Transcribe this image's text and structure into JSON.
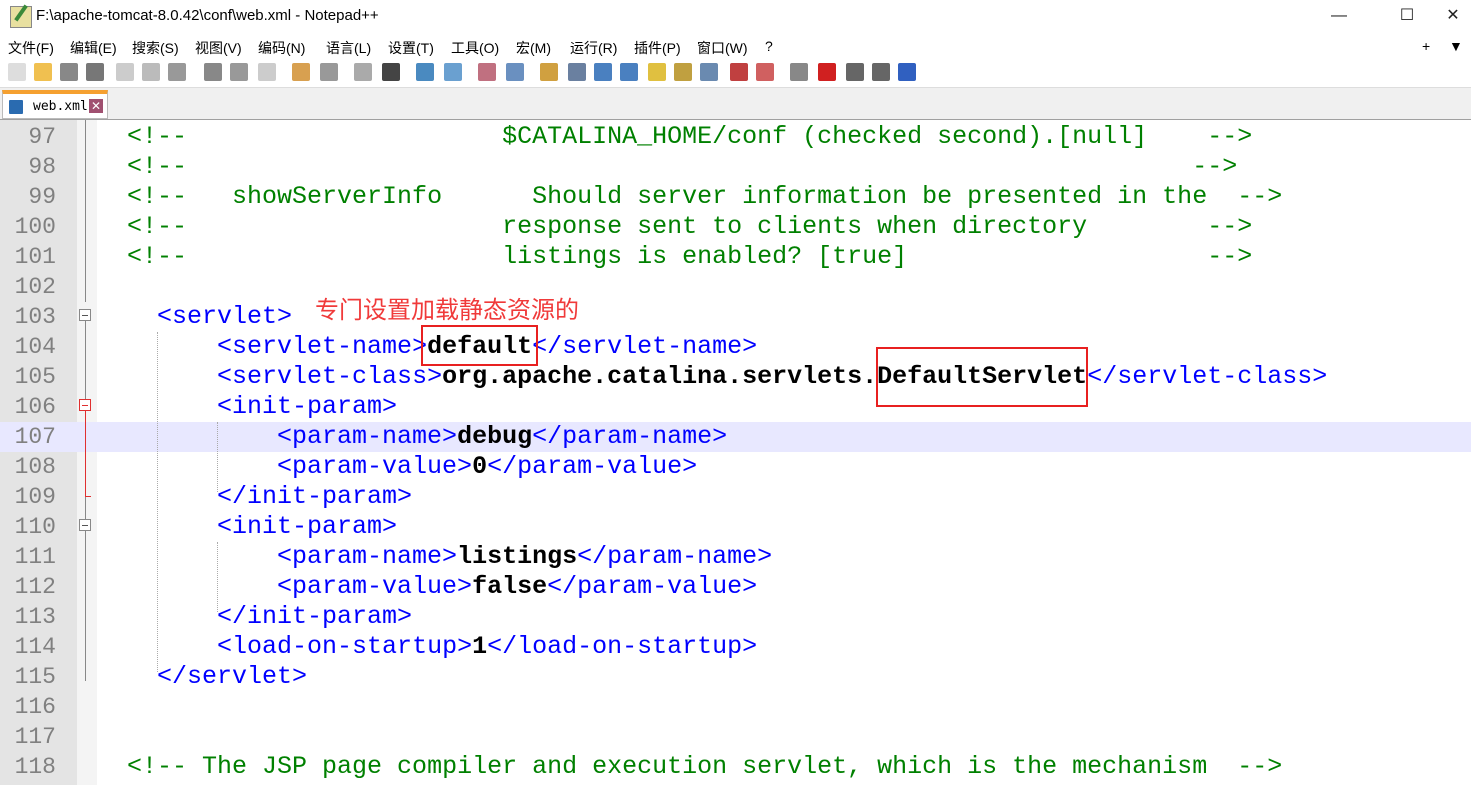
{
  "window": {
    "title": "F:\\apache-tomcat-8.0.42\\conf\\web.xml - Notepad++",
    "minimize": "—",
    "maximize": "☐",
    "close": "✕"
  },
  "menu": [
    "文件(F)",
    "编辑(E)",
    "搜索(S)",
    "视图(V)",
    "编码(N)",
    "语言(L)",
    "设置(T)",
    "工具(O)",
    "宏(M)",
    "运行(R)",
    "插件(P)",
    "窗口(W)",
    "?"
  ],
  "menu_right": {
    "plus": "+",
    "arrow": "▼"
  },
  "tab": {
    "label": "web.xml",
    "close": "✕"
  },
  "annotation": {
    "text": "专门设置加载静态资源的",
    "color": "#e82020"
  },
  "colors": {
    "comment": "#008000",
    "tag": "#0000ff",
    "text": "#000000",
    "current_line": "#e8e8ff"
  },
  "current_line": 107,
  "lines": [
    {
      "n": "97",
      "tokens": [
        [
          "",
          "  "
        ],
        [
          "c",
          "<!--                     $CATALINA_HOME/conf (checked second).[null]    -->"
        ]
      ]
    },
    {
      "n": "98",
      "tokens": [
        [
          "",
          "  "
        ],
        [
          "c",
          "<!--                                                                   -->"
        ]
      ]
    },
    {
      "n": "99",
      "tokens": [
        [
          "",
          "  "
        ],
        [
          "c",
          "<!--   showServerInfo      Should server information be presented in the  -->"
        ]
      ]
    },
    {
      "n": "100",
      "tokens": [
        [
          "",
          "  "
        ],
        [
          "c",
          "<!--                     response sent to clients when directory        -->"
        ]
      ]
    },
    {
      "n": "101",
      "tokens": [
        [
          "",
          "  "
        ],
        [
          "c",
          "<!--                     listings is enabled? [true]                    -->"
        ]
      ]
    },
    {
      "n": "102",
      "tokens": []
    },
    {
      "n": "103",
      "tokens": [
        [
          "",
          "    "
        ],
        [
          "t",
          "<servlet>"
        ]
      ]
    },
    {
      "n": "104",
      "tokens": [
        [
          "",
          "        "
        ],
        [
          "t",
          "<servlet-name>"
        ],
        [
          "x",
          "default"
        ],
        [
          "t",
          "</servlet-name>"
        ]
      ]
    },
    {
      "n": "105",
      "tokens": [
        [
          "",
          "        "
        ],
        [
          "t",
          "<servlet-class>"
        ],
        [
          "x",
          "org.apache.catalina.servlets.DefaultServlet"
        ],
        [
          "t",
          "</servlet-class>"
        ]
      ]
    },
    {
      "n": "106",
      "tokens": [
        [
          "",
          "        "
        ],
        [
          "t",
          "<init-param>"
        ]
      ]
    },
    {
      "n": "107",
      "tokens": [
        [
          "",
          "            "
        ],
        [
          "t",
          "<param-name>"
        ],
        [
          "x",
          "debug"
        ],
        [
          "t",
          "</param-name>"
        ]
      ]
    },
    {
      "n": "108",
      "tokens": [
        [
          "",
          "            "
        ],
        [
          "t",
          "<param-value>"
        ],
        [
          "x",
          "0"
        ],
        [
          "t",
          "</param-value>"
        ]
      ]
    },
    {
      "n": "109",
      "tokens": [
        [
          "",
          "        "
        ],
        [
          "t",
          "</init-param>"
        ]
      ]
    },
    {
      "n": "110",
      "tokens": [
        [
          "",
          "        "
        ],
        [
          "t",
          "<init-param>"
        ]
      ]
    },
    {
      "n": "111",
      "tokens": [
        [
          "",
          "            "
        ],
        [
          "t",
          "<param-name>"
        ],
        [
          "x",
          "listings"
        ],
        [
          "t",
          "</param-name>"
        ]
      ]
    },
    {
      "n": "112",
      "tokens": [
        [
          "",
          "            "
        ],
        [
          "t",
          "<param-value>"
        ],
        [
          "x",
          "false"
        ],
        [
          "t",
          "</param-value>"
        ]
      ]
    },
    {
      "n": "113",
      "tokens": [
        [
          "",
          "        "
        ],
        [
          "t",
          "</init-param>"
        ]
      ]
    },
    {
      "n": "114",
      "tokens": [
        [
          "",
          "        "
        ],
        [
          "t",
          "<load-on-startup>"
        ],
        [
          "x",
          "1"
        ],
        [
          "t",
          "</load-on-startup>"
        ]
      ]
    },
    {
      "n": "115",
      "tokens": [
        [
          "",
          "    "
        ],
        [
          "t",
          "</servlet>"
        ]
      ]
    },
    {
      "n": "116",
      "tokens": []
    },
    {
      "n": "117",
      "tokens": []
    },
    {
      "n": "118",
      "tokens": [
        [
          "",
          "  "
        ],
        [
          "c",
          "<!-- The JSP page compiler and execution servlet, which is the mechanism  -->"
        ]
      ]
    }
  ]
}
